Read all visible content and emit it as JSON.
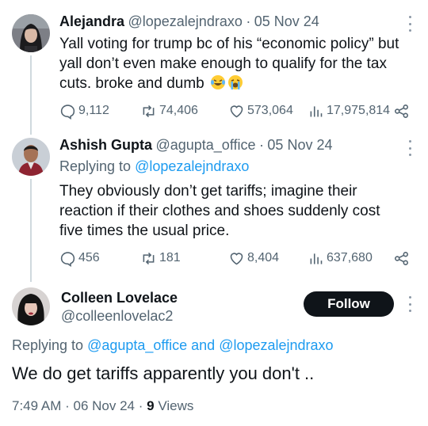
{
  "tweets": [
    {
      "name": "Alejandra",
      "handle": "@lopezalejndraxo",
      "sep": "·",
      "date": "05 Nov 24",
      "text_line1": "Yall voting for trump bc of his “economic policy” but",
      "text_line2": "yall don’t even make enough to qualify for the tax",
      "text_line3": "cuts. broke and dumb",
      "emoji": [
        "laughing-tears",
        "crying"
      ],
      "replies": "9,112",
      "reposts": "74,406",
      "likes": "573,064",
      "views": "17,975,814"
    },
    {
      "name": "Ashish Gupta",
      "handle": "@agupta_office",
      "sep": "·",
      "date": "05 Nov 24",
      "replying_prefix": "Replying to",
      "replying_to": "@lopezalejndraxo",
      "text_line1": "They obviously don’t get tariffs; imagine their",
      "text_line2": "reaction if their clothes and shoes suddenly cost",
      "text_line3": "five times the usual price.",
      "replies": "456",
      "reposts": "181",
      "likes": "8,404",
      "views": "637,680"
    }
  ],
  "main": {
    "name": "Colleen Lovelace",
    "handle": "@colleenlovelac2",
    "follow_label": "Follow",
    "replying_prefix": "Replying to",
    "replying_to_1": "@agupta_office",
    "replying_and": "and",
    "replying_to_2": "@lopezalejndraxo",
    "text": "We do get tariffs apparently you don't ..",
    "time": "7:49 AM",
    "sep1": "·",
    "date": "06 Nov 24",
    "sep2": "·",
    "views_count": "9",
    "views_label": "Views"
  },
  "colors": {
    "link": "#1d9bf0",
    "secondary_text": "#536471",
    "primary_text": "#0f1419",
    "follow_bg": "#0f1419"
  }
}
